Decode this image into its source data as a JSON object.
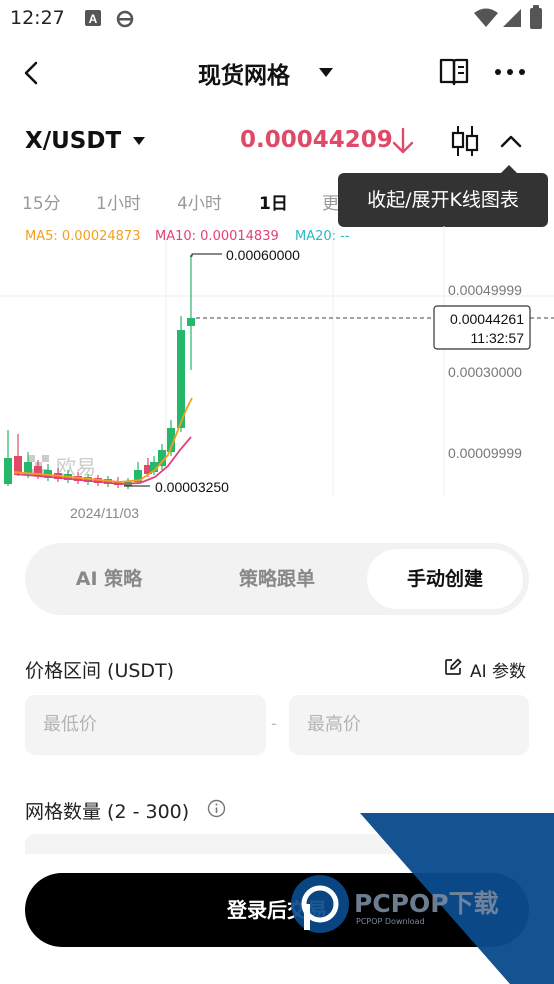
{
  "status_bar": {
    "time": "12:27",
    "icons": [
      "a-badge-icon",
      "e-browser-icon",
      "wifi-icon",
      "signal-icon",
      "battery-icon"
    ]
  },
  "nav": {
    "title": "现货网格",
    "icons": [
      "back-icon",
      "chevron-down-icon",
      "book-icon",
      "more-icon"
    ]
  },
  "pair": {
    "name": "X/USDT",
    "price": "0.00044209",
    "price_color": "#e04a69"
  },
  "timeframes": [
    {
      "label": "15分",
      "active": false
    },
    {
      "label": "1小时",
      "active": false
    },
    {
      "label": "4小时",
      "active": false
    },
    {
      "label": "1日",
      "active": true
    },
    {
      "label": "更",
      "active": false
    }
  ],
  "tooltip": {
    "text": "收起/展开K线图表"
  },
  "ma": {
    "ma5": {
      "label": "MA5: 0.00024873",
      "color": "#f0a020"
    },
    "ma10": {
      "label": "MA10: 0.00014839",
      "color": "#e0407a"
    },
    "ma20": {
      "label": "MA20: --",
      "color": "#28b8c8"
    }
  },
  "chart_data": {
    "type": "candlestick",
    "y_ticks": [
      "0.00049999",
      "0.00030000",
      "0.00009999"
    ],
    "high_label": "0.00060000",
    "low_label": "0.00003250",
    "current_price_label": "0.00044261",
    "current_time_label": "11:32:57",
    "x_label": "2024/11/03",
    "watermark": "欧易",
    "up_color": "#26b86a",
    "down_color": "#e04a69"
  },
  "segments": [
    {
      "label": "AI 策略",
      "active": false
    },
    {
      "label": "策略跟单",
      "active": false
    },
    {
      "label": "手动创建",
      "active": true
    }
  ],
  "price_range": {
    "label": "价格区间 (USDT)",
    "ai_label": "AI 参数",
    "min_placeholder": "最低价",
    "max_placeholder": "最高价",
    "dash": "-"
  },
  "grid_count": {
    "label": "网格数量 (2 - 300)"
  },
  "login_button": "登录后交易",
  "watermark_text": {
    "brand": "PCPOP下载",
    "sub": "PCPOP Download"
  }
}
